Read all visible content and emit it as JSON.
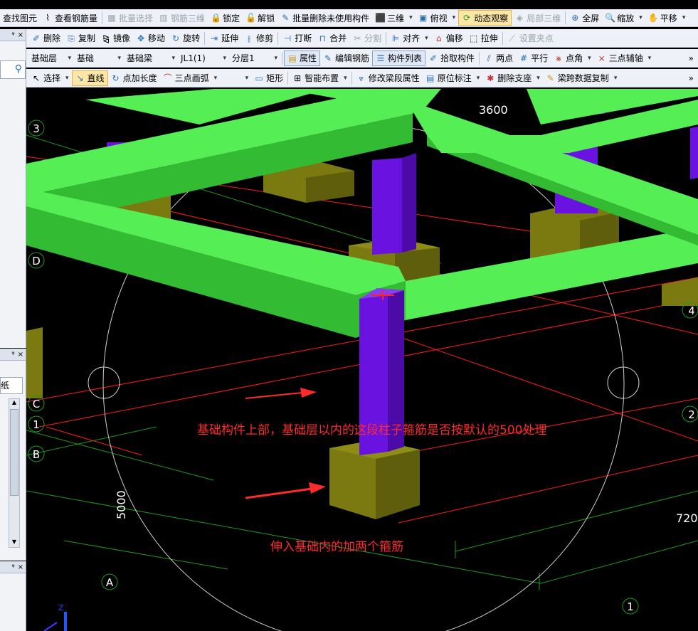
{
  "toolbar1": {
    "items": [
      {
        "label": "查找图元",
        "icon": "find-icon"
      },
      {
        "label": "查看钢筋量",
        "icon": "rebar-amount-icon"
      },
      {
        "label": "批量选择",
        "icon": "batch-select-icon",
        "disabled": true
      },
      {
        "label": "钢筋三维",
        "icon": "rebar-3d-icon",
        "disabled": true
      },
      {
        "label": "锁定",
        "icon": "lock-icon"
      },
      {
        "label": "解锁",
        "icon": "unlock-icon"
      },
      {
        "label": "批量删除未使用构件",
        "icon": "batch-delete-icon"
      },
      {
        "label": "三维",
        "icon": "cube-icon"
      },
      {
        "label": "俯视",
        "icon": "top-view-icon"
      },
      {
        "label": "动态观察",
        "icon": "dynamic-orbit-icon"
      },
      {
        "label": "局部三维",
        "icon": "partial-3d-icon",
        "disabled": true
      },
      {
        "label": "全屏",
        "icon": "fullscreen-icon"
      },
      {
        "label": "缩放",
        "icon": "zoom-icon"
      },
      {
        "label": "平移",
        "icon": "pan-icon"
      }
    ]
  },
  "toolbar2": {
    "items": [
      {
        "label": "删除",
        "icon": "delete-icon"
      },
      {
        "label": "复制",
        "icon": "copy-icon"
      },
      {
        "label": "镜像",
        "icon": "mirror-icon"
      },
      {
        "label": "移动",
        "icon": "move-icon"
      },
      {
        "label": "旋转",
        "icon": "rotate-icon"
      },
      {
        "label": "延伸",
        "icon": "extend-icon"
      },
      {
        "label": "修剪",
        "icon": "trim-icon"
      },
      {
        "label": "打断",
        "icon": "break-icon"
      },
      {
        "label": "合并",
        "icon": "merge-icon"
      },
      {
        "label": "分割",
        "icon": "split-icon",
        "disabled": true
      },
      {
        "label": "对齐",
        "icon": "align-icon"
      },
      {
        "label": "偏移",
        "icon": "offset-icon"
      },
      {
        "label": "拉伸",
        "icon": "stretch-icon"
      },
      {
        "label": "设置夹点",
        "icon": "grip-icon",
        "disabled": true
      }
    ]
  },
  "toolbar3": {
    "floor": "基础层",
    "category": "基础",
    "element_type": "基础梁",
    "element": "JL1(1)",
    "layer": "分层1",
    "properties": "属性",
    "edit_rebar": "编辑钢筋",
    "component_list": "构件列表",
    "pick_component": "拾取构件",
    "two_points": "两点",
    "parallel": "平行",
    "point_angle": "点角",
    "three_point_aux": "三点辅轴",
    "more": "»"
  },
  "toolbar4": {
    "select": "选择",
    "line": "直线",
    "point_length": "点加长度",
    "three_point_arc": "三点画弧",
    "rectangle": "矩形",
    "smart_layout": "智能布置",
    "modify_beam_props": "修改梁段属性",
    "in_situ_label": "原位标注",
    "delete_support": "删除支座",
    "copy_beam_data": "梁跨数据复制",
    "more": "»"
  },
  "panels": {
    "pin": "ᵠ",
    "close": "×",
    "panel2_text": "纸"
  },
  "axes": {
    "labels": [
      "3",
      "D",
      "C",
      "1",
      "B",
      "A",
      "4",
      "2",
      "1"
    ],
    "dims": [
      "3600",
      "5000",
      "720"
    ],
    "z_label": "Z"
  },
  "annotations": {
    "note1": "基础构件上部，基础层以内的这段柱子箍筋是否按默认的500处理",
    "note2": "伸入基础内的加两个箍筋"
  },
  "colors": {
    "beam_top": "#55ee55",
    "beam_side": "#33bb33",
    "column": "#6a12e0",
    "footing": "#7a7a10",
    "axis_red": "#ff1a1a",
    "axis_green": "#1f9a1f",
    "annotation": "#ff2b2b"
  }
}
